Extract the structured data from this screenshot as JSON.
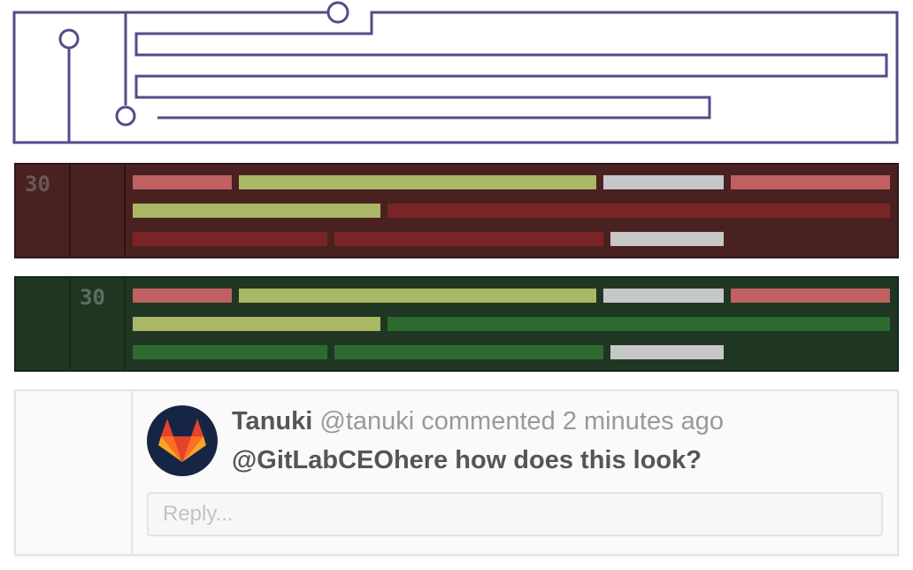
{
  "colors": {
    "graph_stroke": "#574a8a",
    "removed_bg": "#4a2121",
    "added_bg": "#1f3722",
    "token_red": "#c06060",
    "token_olive": "#aab764",
    "token_gray": "#c7c7c7",
    "token_dark_red": "#7a2525",
    "token_dark_green": "#2c6a2f",
    "avatar_bg": "#162543"
  },
  "diff": {
    "removed": {
      "old_line": "30",
      "new_line": ""
    },
    "added": {
      "old_line": "",
      "new_line": "30"
    }
  },
  "comment": {
    "author_name": "Tanuki",
    "author_handle": "@tanuki",
    "action": "commented",
    "time": "2 minutes ago",
    "body": "@GitLabCEOhere how does this look?",
    "avatar_icon": "gitlab-tanuki-icon"
  },
  "reply": {
    "placeholder": "Reply..."
  }
}
